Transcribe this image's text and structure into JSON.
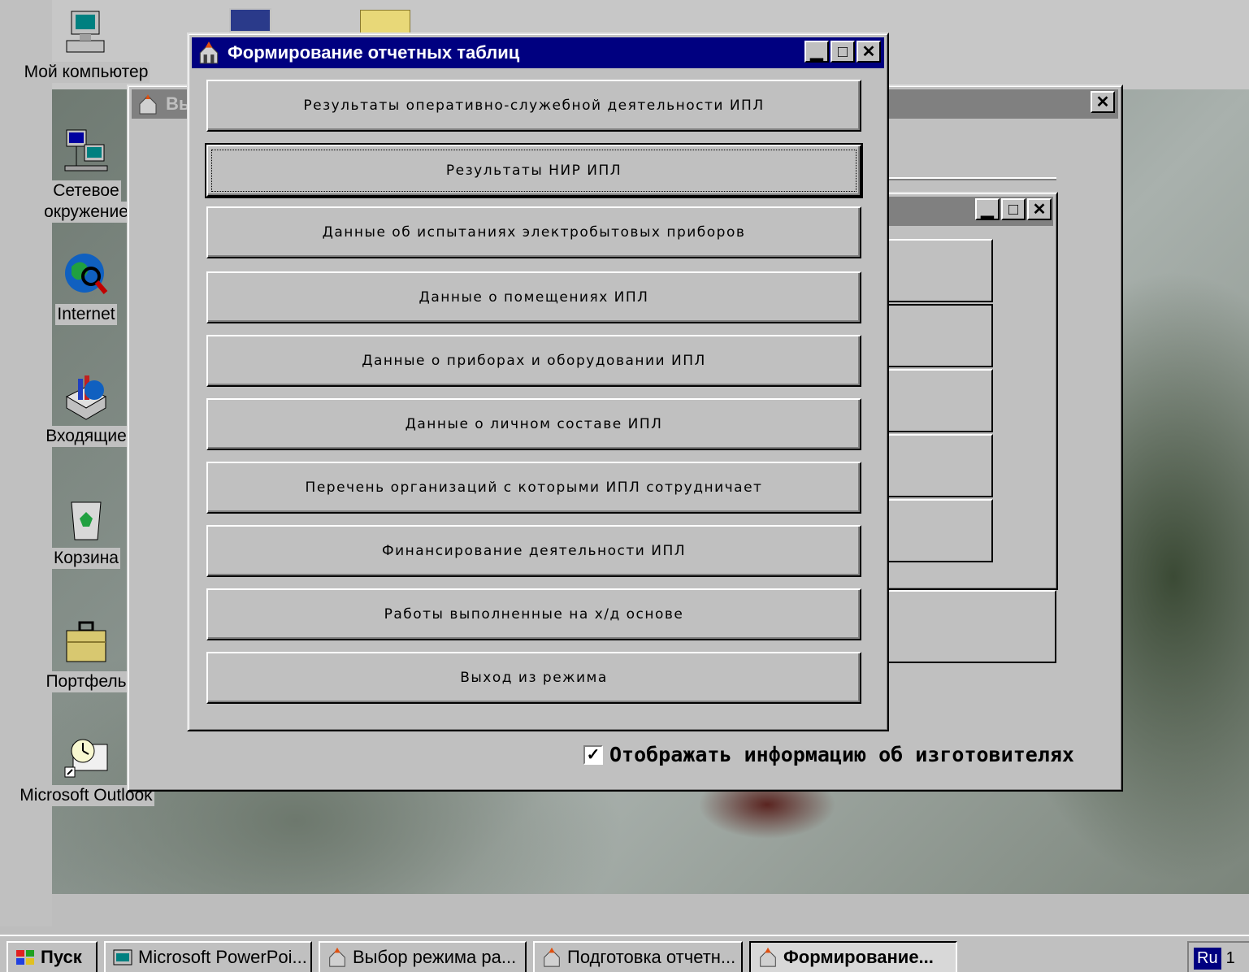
{
  "desktop": {
    "icons": [
      {
        "label": "Мой компьютер",
        "icon": "my-computer-icon"
      },
      {
        "label": "Сетевое",
        "label2": "окружение",
        "icon": "network-neighborhood-icon"
      },
      {
        "label": "Internet",
        "icon": "internet-icon"
      },
      {
        "label": "Входящие",
        "icon": "inbox-icon"
      },
      {
        "label": "Корзина",
        "icon": "recycle-bin-icon"
      },
      {
        "label": "Портфель",
        "icon": "briefcase-icon"
      },
      {
        "label": "Microsoft Outlook",
        "icon": "outlook-icon"
      }
    ]
  },
  "back_window": {
    "title": "Вы"
  },
  "main_window": {
    "title": "Формирование отчетных таблиц",
    "buttons": [
      "Результаты оперативно-служебной деятельности ИПЛ",
      "Результаты НИР ИПЛ",
      "Данные об испытаниях электробытовых приборов",
      "Данные о помещениях ИПЛ",
      "Данные о приборах и оборудовании ИПЛ",
      "Данные о личном составе ИПЛ",
      "Перечень организаций с которыми ИПЛ сотрудничает",
      "Финансирование деятельности ИПЛ",
      "Работы выполненные на х/д основе",
      "Выход из режима"
    ]
  },
  "checkbox": {
    "label": "Отображать информацию об изготовителях",
    "checked": true
  },
  "taskbar": {
    "start": "Пуск",
    "tasks": [
      "Microsoft PowerPoi...",
      "Выбор режима ра...",
      "Подготовка отчетн...",
      "Формирование..."
    ],
    "tray_lang": "Ru",
    "tray_clock": "1"
  },
  "colors": {
    "active_title": "#000080",
    "inactive_title": "#808080",
    "face": "#c0c0c0"
  }
}
